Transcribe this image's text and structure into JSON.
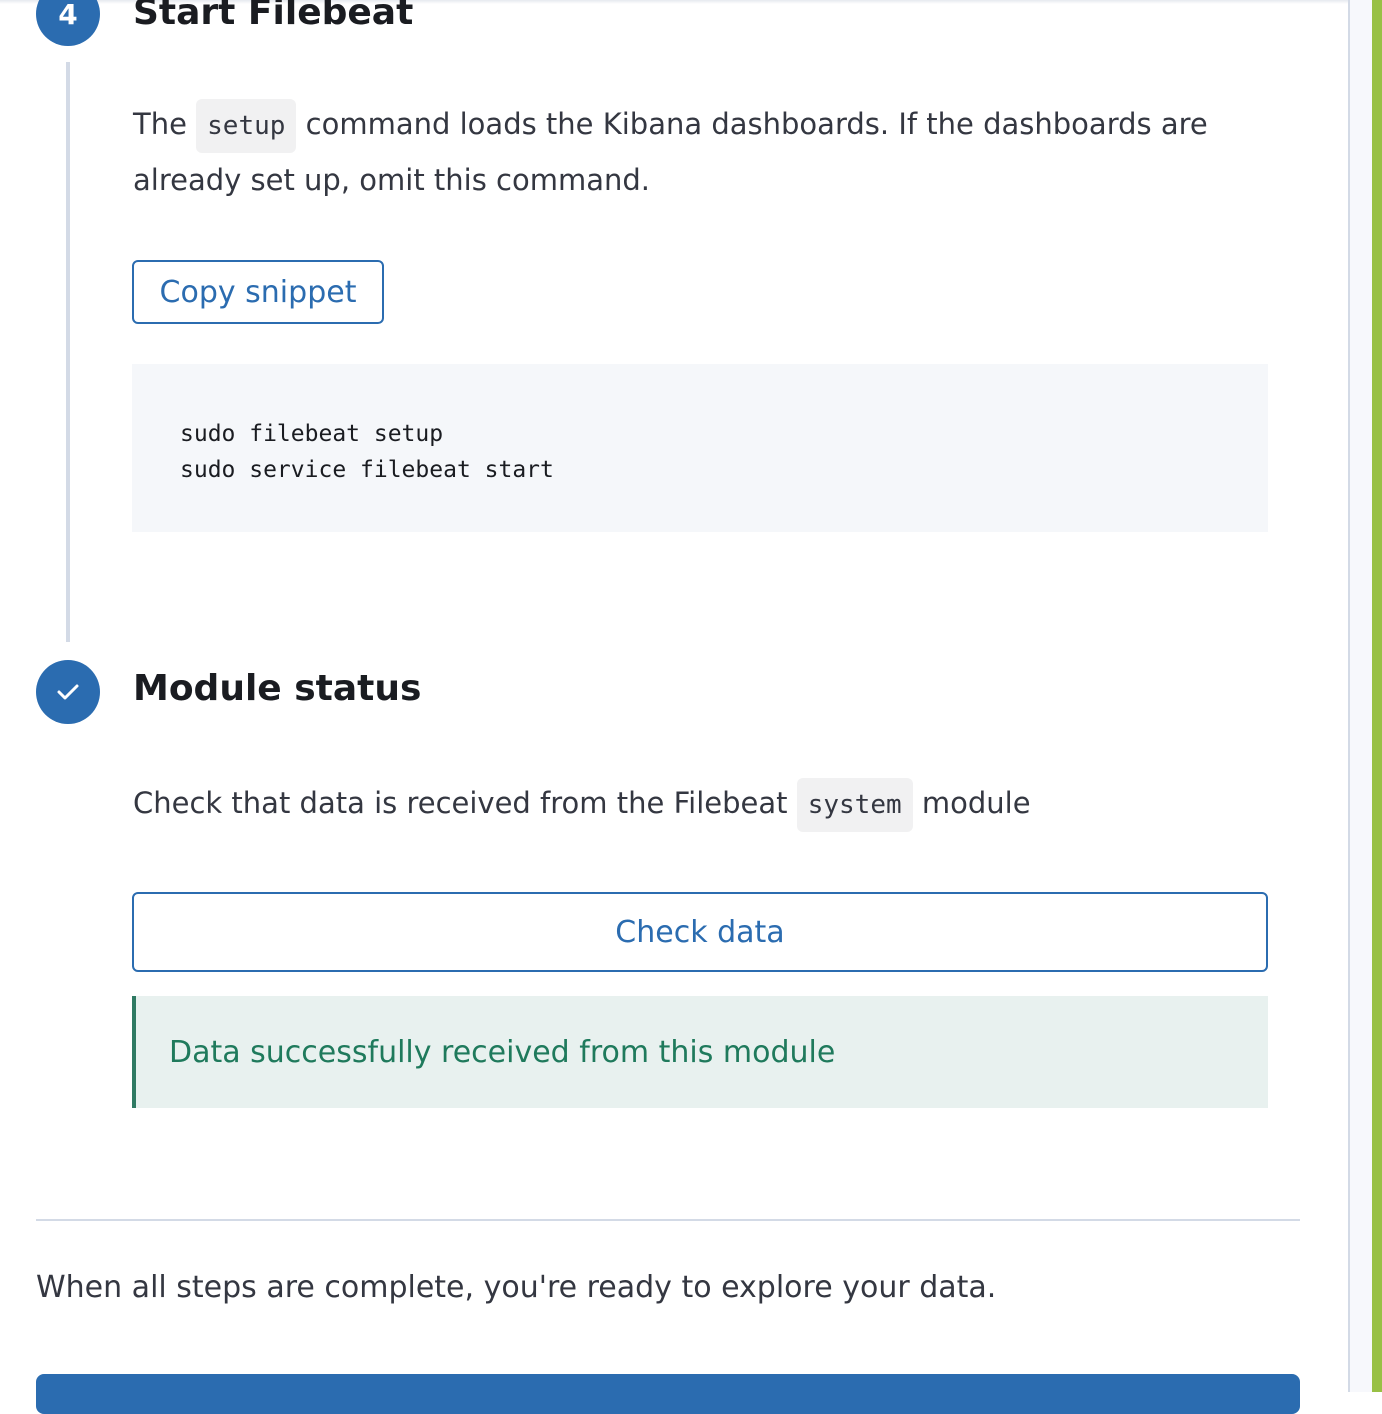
{
  "steps": [
    {
      "number": "4",
      "title": "Start Filebeat",
      "text_before": "The ",
      "code": "setup",
      "text_after": " command loads the Kibana dashboards. If the dashboards are already set up, omit this command.",
      "copy_label": "Copy snippet",
      "snippet": "sudo filebeat setup\nsudo service filebeat start"
    },
    {
      "icon": "check-icon",
      "title": "Module status",
      "text_before": "Check that data is received from the Filebeat ",
      "code": "system",
      "text_after": " module",
      "check_label": "Check data",
      "success_message": "Data successfully received from this module"
    }
  ],
  "footer": {
    "text": "When all steps are complete, you're ready to explore your data."
  },
  "colors": {
    "primary": "#2b6cb0",
    "success": "#1f7a5c",
    "accent_strip": "#98c045"
  }
}
